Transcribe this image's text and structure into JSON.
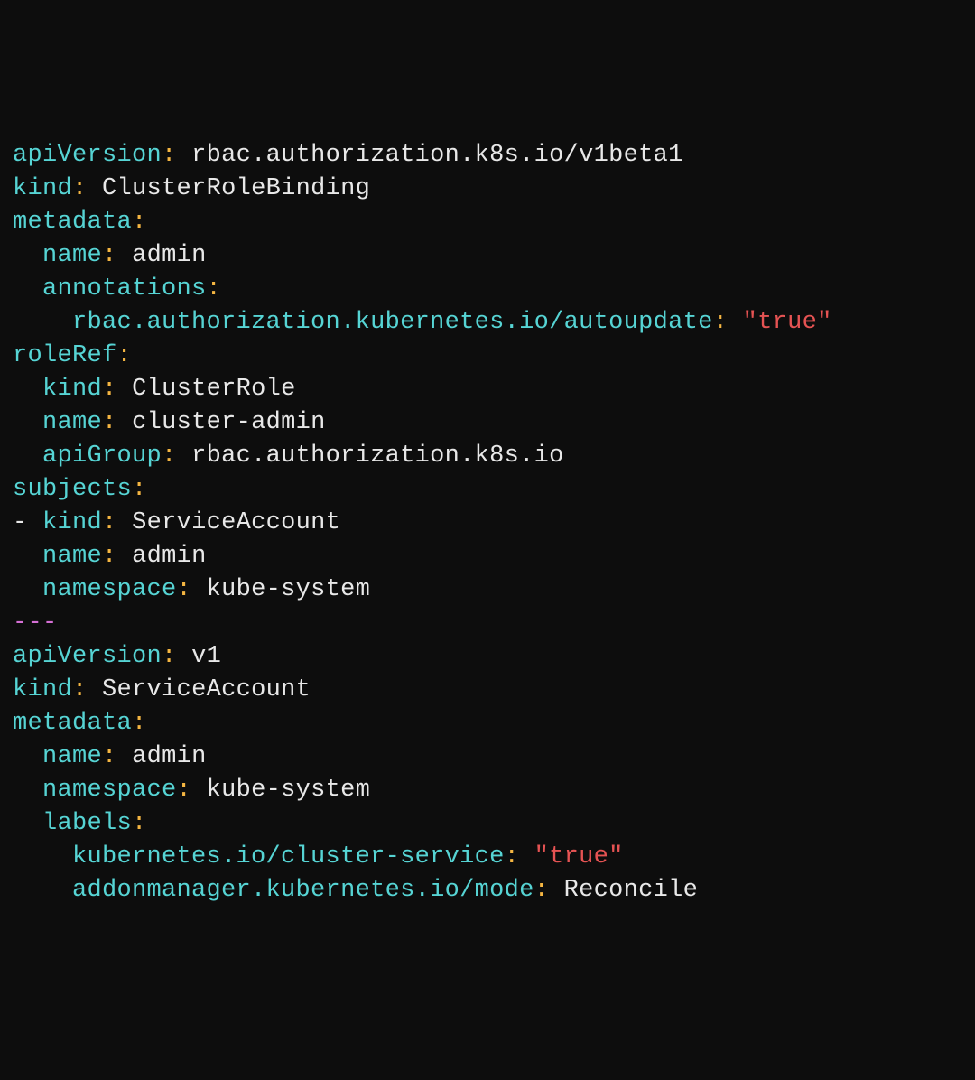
{
  "yaml": {
    "doc1": {
      "apiVersion_key": "apiVersion",
      "apiVersion_val": "rbac.authorization.k8s.io/v1beta1",
      "kind_key": "kind",
      "kind_val": "ClusterRoleBinding",
      "metadata_key": "metadata",
      "name_key": "name",
      "name_val": "admin",
      "annotations_key": "annotations",
      "annotation_key": "rbac.authorization.kubernetes.io/autoupdate",
      "annotation_val": "\"true\"",
      "roleRef_key": "roleRef",
      "roleRef_kind_key": "kind",
      "roleRef_kind_val": "ClusterRole",
      "roleRef_name_key": "name",
      "roleRef_name_val": "cluster-admin",
      "roleRef_apiGroup_key": "apiGroup",
      "roleRef_apiGroup_val": "rbac.authorization.k8s.io",
      "subjects_key": "subjects",
      "subject_kind_key": "kind",
      "subject_kind_val": "ServiceAccount",
      "subject_name_key": "name",
      "subject_name_val": "admin",
      "subject_namespace_key": "namespace",
      "subject_namespace_val": "kube-system"
    },
    "separator": "---",
    "doc2": {
      "apiVersion_key": "apiVersion",
      "apiVersion_val": "v1",
      "kind_key": "kind",
      "kind_val": "ServiceAccount",
      "metadata_key": "metadata",
      "name_key": "name",
      "name_val": "admin",
      "namespace_key": "namespace",
      "namespace_val": "kube-system",
      "labels_key": "labels",
      "label1_key": "kubernetes.io/cluster-service",
      "label1_val": "\"true\"",
      "label2_key": "addonmanager.kubernetes.io/mode",
      "label2_val": "Reconcile"
    }
  },
  "colon": ":",
  "dash": "-",
  "space": " "
}
